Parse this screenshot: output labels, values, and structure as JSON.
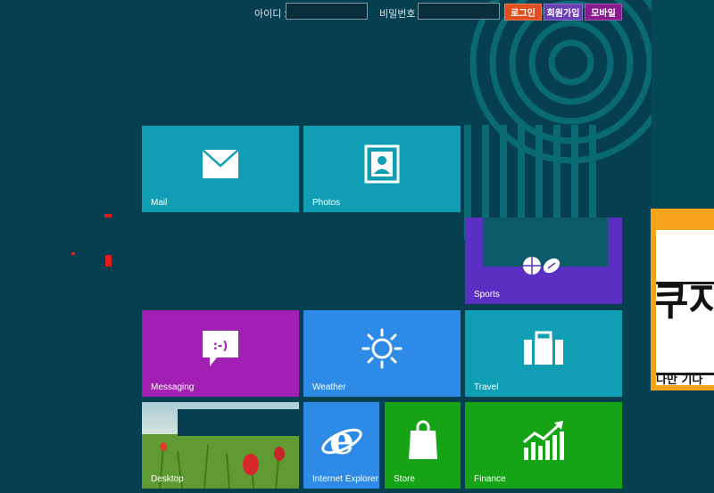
{
  "login": {
    "id_label": "아이디 :",
    "id_value": "",
    "password_label": "비밀번호 :",
    "password_value": "",
    "login_button": "로그인",
    "signup_button": "회원가입",
    "mobile_button": "모바일"
  },
  "colors": {
    "background": "#053f50",
    "login_button": "#e0501f",
    "signup_button": "#6a3fb4",
    "mobile_button": "#8a1a8f",
    "tile_teal": "#0f9eb3",
    "tile_purple": "#5a2fc2",
    "tile_magenta": "#a11fb2",
    "tile_blue": "#2d8be7",
    "tile_green": "#16a316",
    "banner_border": "#f5a318"
  },
  "tiles": [
    {
      "label": "Mail",
      "icon": "mail-icon"
    },
    {
      "label": "Photos",
      "icon": "photos-icon"
    },
    {
      "label": "Sports",
      "icon": "sports-icon"
    },
    {
      "label": "Messaging",
      "icon": "messaging-icon"
    },
    {
      "label": "Weather",
      "icon": "weather-icon"
    },
    {
      "label": "Travel",
      "icon": "travel-icon"
    },
    {
      "label": "Desktop",
      "icon": "desktop-wallpaper"
    },
    {
      "label": "Internet Explorer",
      "icon": "internet-explorer-icon"
    },
    {
      "label": "Store",
      "icon": "store-icon"
    },
    {
      "label": "Finance",
      "icon": "finance-icon"
    }
  ],
  "banner": {
    "big_text": "쿠지",
    "small_text": "나만 기다"
  }
}
